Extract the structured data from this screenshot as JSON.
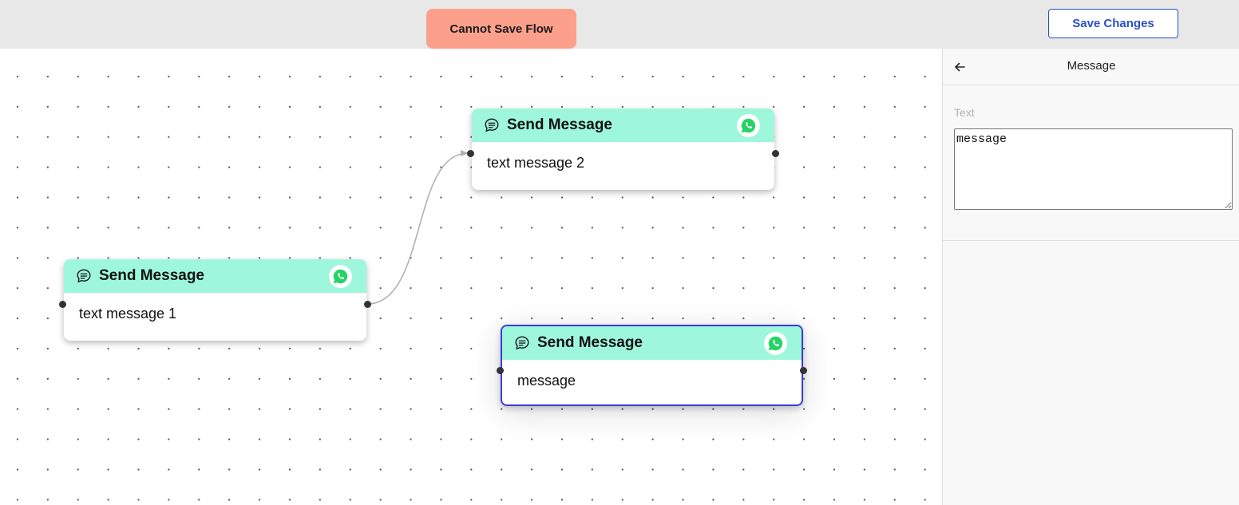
{
  "topbar": {
    "error_message": "Cannot Save Flow",
    "save_label": "Save Changes"
  },
  "canvas": {
    "nodes": [
      {
        "title": "Send Message",
        "text": "text message 1",
        "selected": false
      },
      {
        "title": "Send Message",
        "text": "text message 2",
        "selected": false
      },
      {
        "title": "Send Message",
        "text": "message",
        "selected": true
      }
    ],
    "edges": [
      {
        "from": "node-1",
        "to": "node-2"
      }
    ]
  },
  "settings_panel": {
    "title": "Message",
    "field_label": "Text",
    "field_value": "message"
  },
  "icons": {
    "node_icon": "chat-bubble-icon",
    "channel_icon": "whatsapp-icon",
    "back_icon": "arrow-left-icon"
  },
  "colors": {
    "node_header": "#9ef7db",
    "error_banner": "#fca08c",
    "primary": "#2b4fc7",
    "selected_border": "#3b3bdc",
    "whatsapp": "#25d366"
  }
}
